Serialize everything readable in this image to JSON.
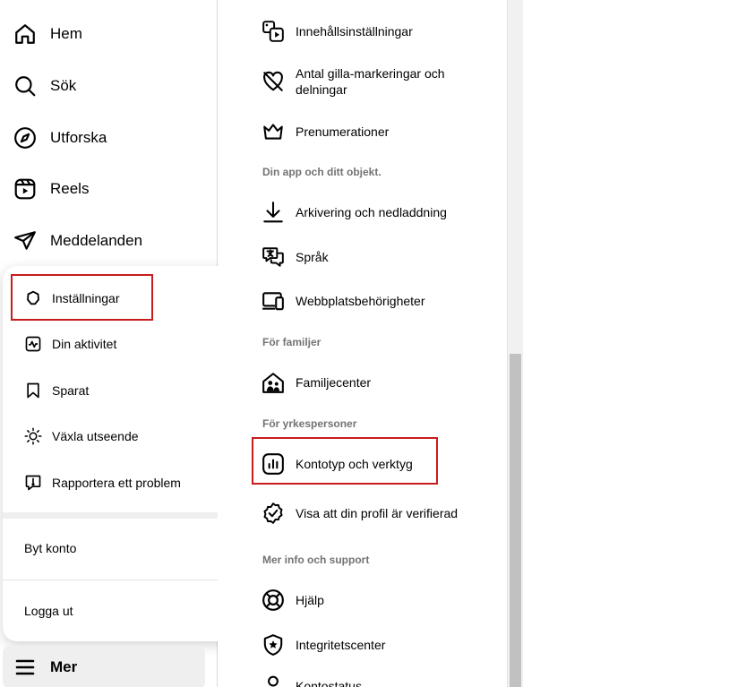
{
  "nav": {
    "items": [
      {
        "label": "Hem",
        "icon": "home-icon"
      },
      {
        "label": "Sök",
        "icon": "search-icon"
      },
      {
        "label": "Utforska",
        "icon": "compass-icon"
      },
      {
        "label": "Reels",
        "icon": "reels-icon"
      },
      {
        "label": "Meddelanden",
        "icon": "send-icon"
      }
    ],
    "more_label": "Mer"
  },
  "more_menu": {
    "items": [
      {
        "label": "Inställningar",
        "icon": "gear-icon"
      },
      {
        "label": "Din aktivitet",
        "icon": "activity-icon"
      },
      {
        "label": "Sparat",
        "icon": "bookmark-icon"
      },
      {
        "label": "Växla utseende",
        "icon": "sun-icon"
      },
      {
        "label": "Rapportera ett problem",
        "icon": "report-icon"
      }
    ],
    "switch_account": "Byt konto",
    "logout": "Logga ut"
  },
  "settings": {
    "items": [
      {
        "label": "Innehållsinställningar",
        "icon": "content-settings-icon"
      },
      {
        "label": "Antal gilla-markeringar och delningar",
        "icon": "heart-crossed-icon"
      },
      {
        "label": "Prenumerationer",
        "icon": "crown-icon"
      }
    ],
    "section_app": "Din app och ditt objekt.",
    "app_items": [
      {
        "label": "Arkivering och nedladdning",
        "icon": "download-icon"
      },
      {
        "label": "Språk",
        "icon": "language-icon"
      },
      {
        "label": "Webbplatsbehörigheter",
        "icon": "devices-icon"
      }
    ],
    "section_family": "För familjer",
    "family_items": [
      {
        "label": "Familjecenter",
        "icon": "family-home-icon"
      }
    ],
    "section_pro": "För yrkespersoner",
    "pro_items": [
      {
        "label": "Kontotyp och verktyg",
        "icon": "bar-chart-icon"
      },
      {
        "label": "Visa att din profil är verifierad",
        "icon": "verified-badge-icon"
      }
    ],
    "section_support": "Mer info och support",
    "support_items": [
      {
        "label": "Hjälp",
        "icon": "lifebuoy-icon"
      },
      {
        "label": "Integritetscenter",
        "icon": "shield-star-icon"
      },
      {
        "label": "Kontostatus",
        "icon": "person-icon"
      }
    ]
  },
  "colors": {
    "highlight": "#c91c1c",
    "section_heading": "#737373",
    "mer_background": "#efefef"
  }
}
